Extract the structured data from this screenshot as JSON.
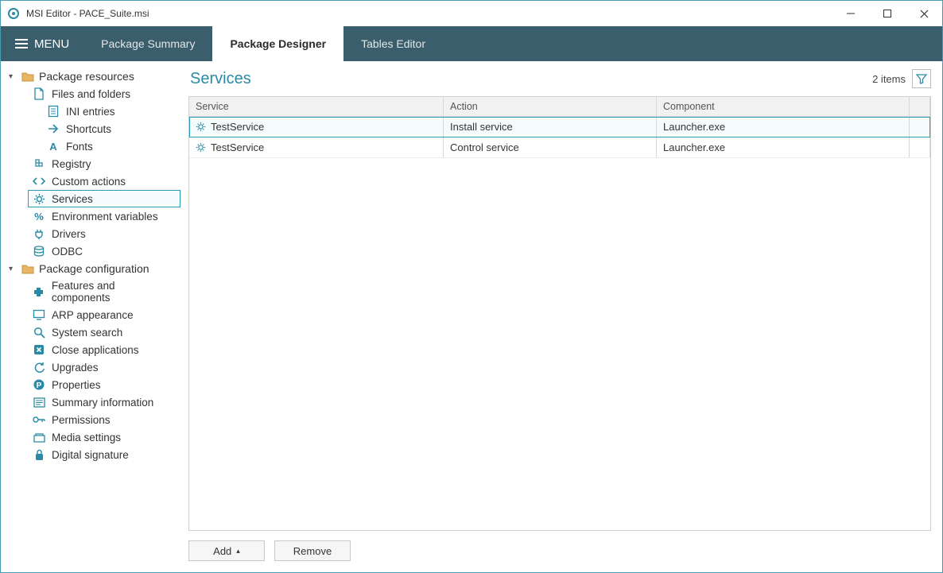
{
  "window": {
    "title": "MSI Editor - PACE_Suite.msi"
  },
  "menu": {
    "label": "MENU",
    "tabs": [
      {
        "label": "Package Summary",
        "active": false
      },
      {
        "label": "Package Designer",
        "active": true
      },
      {
        "label": "Tables Editor",
        "active": false
      }
    ]
  },
  "sidebar": {
    "groups": [
      {
        "label": "Package resources",
        "items": [
          {
            "label": "Files and folders",
            "icon": "file"
          },
          {
            "label": "INI entries",
            "icon": "ini",
            "indent": true
          },
          {
            "label": "Shortcuts",
            "icon": "shortcut",
            "indent": true
          },
          {
            "label": "Fonts",
            "icon": "font",
            "indent": true
          },
          {
            "label": "Registry",
            "icon": "registry"
          },
          {
            "label": "Custom actions",
            "icon": "customaction"
          },
          {
            "label": "Services",
            "icon": "gear",
            "selected": true
          },
          {
            "label": "Environment variables",
            "icon": "percent"
          },
          {
            "label": "Drivers",
            "icon": "plug"
          },
          {
            "label": "ODBC",
            "icon": "db"
          }
        ]
      },
      {
        "label": "Package configuration",
        "items": [
          {
            "label": "Features and components",
            "icon": "puzzle"
          },
          {
            "label": "ARP appearance",
            "icon": "monitor"
          },
          {
            "label": "System search",
            "icon": "search"
          },
          {
            "label": "Close applications",
            "icon": "close"
          },
          {
            "label": "Upgrades",
            "icon": "refresh"
          },
          {
            "label": "Properties",
            "icon": "p"
          },
          {
            "label": "Summary information",
            "icon": "summary"
          },
          {
            "label": "Permissions",
            "icon": "key"
          },
          {
            "label": "Media settings",
            "icon": "media"
          },
          {
            "label": "Digital signature",
            "icon": "lock"
          }
        ]
      }
    ]
  },
  "page": {
    "title": "Services",
    "count_label": "2 items",
    "columns": {
      "service": "Service",
      "action": "Action",
      "component": "Component"
    },
    "rows": [
      {
        "service": "TestService",
        "action": "Install service",
        "component": "Launcher.exe",
        "selected": true
      },
      {
        "service": "TestService",
        "action": "Control service",
        "component": "Launcher.exe",
        "selected": false
      }
    ],
    "buttons": {
      "add": "Add",
      "remove": "Remove"
    }
  }
}
